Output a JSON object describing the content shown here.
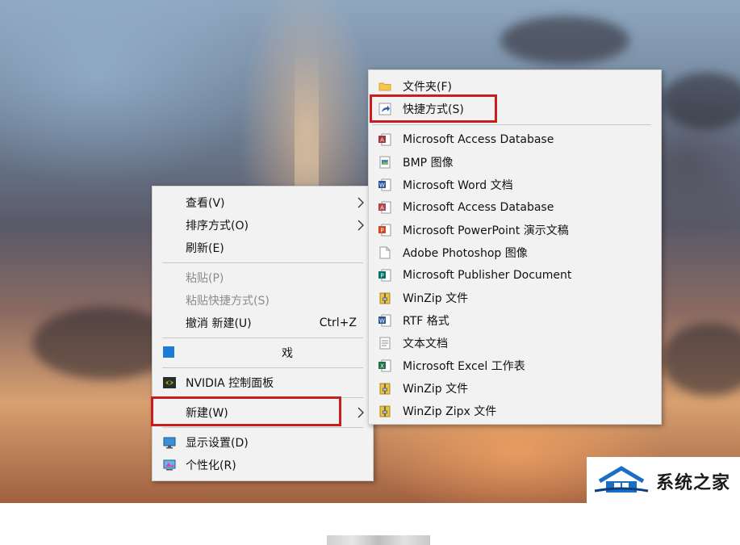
{
  "context_menu": {
    "items": [
      {
        "label": "查看(V)"
      },
      {
        "label": "排序方式(O)"
      },
      {
        "label": "刷新(E)"
      },
      {
        "label": "粘贴(P)"
      },
      {
        "label": "粘贴快捷方式(S)"
      },
      {
        "label": "撤消 新建(U)",
        "shortcut": "Ctrl+Z"
      },
      {
        "label": "戏"
      },
      {
        "label": "NVIDIA 控制面板"
      },
      {
        "label": "新建(W)"
      },
      {
        "label": "显示设置(D)"
      },
      {
        "label": "个性化(R)"
      }
    ]
  },
  "submenu": {
    "items": [
      {
        "label": "文件夹(F)",
        "icon": "folder-icon"
      },
      {
        "label": "快捷方式(S)",
        "icon": "shortcut-icon"
      },
      {
        "label": "Microsoft Access Database",
        "icon": "access-icon"
      },
      {
        "label": "BMP 图像",
        "icon": "bmp-image-icon"
      },
      {
        "label": "Microsoft Word 文档",
        "icon": "word-icon"
      },
      {
        "label": "Microsoft Access Database",
        "icon": "access-icon"
      },
      {
        "label": "Microsoft PowerPoint 演示文稿",
        "icon": "powerpoint-icon"
      },
      {
        "label": "Adobe Photoshop 图像",
        "icon": "blank-file-icon"
      },
      {
        "label": "Microsoft Publisher Document",
        "icon": "publisher-icon"
      },
      {
        "label": "WinZip 文件",
        "icon": "winzip-icon"
      },
      {
        "label": "RTF 格式",
        "icon": "rtf-icon"
      },
      {
        "label": "文本文档",
        "icon": "text-file-icon"
      },
      {
        "label": "Microsoft Excel 工作表",
        "icon": "excel-icon"
      },
      {
        "label": "WinZip 文件",
        "icon": "winzip-icon"
      },
      {
        "label": "WinZip Zipx 文件",
        "icon": "winzip-icon"
      }
    ]
  },
  "watermark": {
    "text": "系统之家"
  },
  "colors": {
    "highlight": "#c81e1e",
    "menu_bg": "#f2f2f2"
  }
}
